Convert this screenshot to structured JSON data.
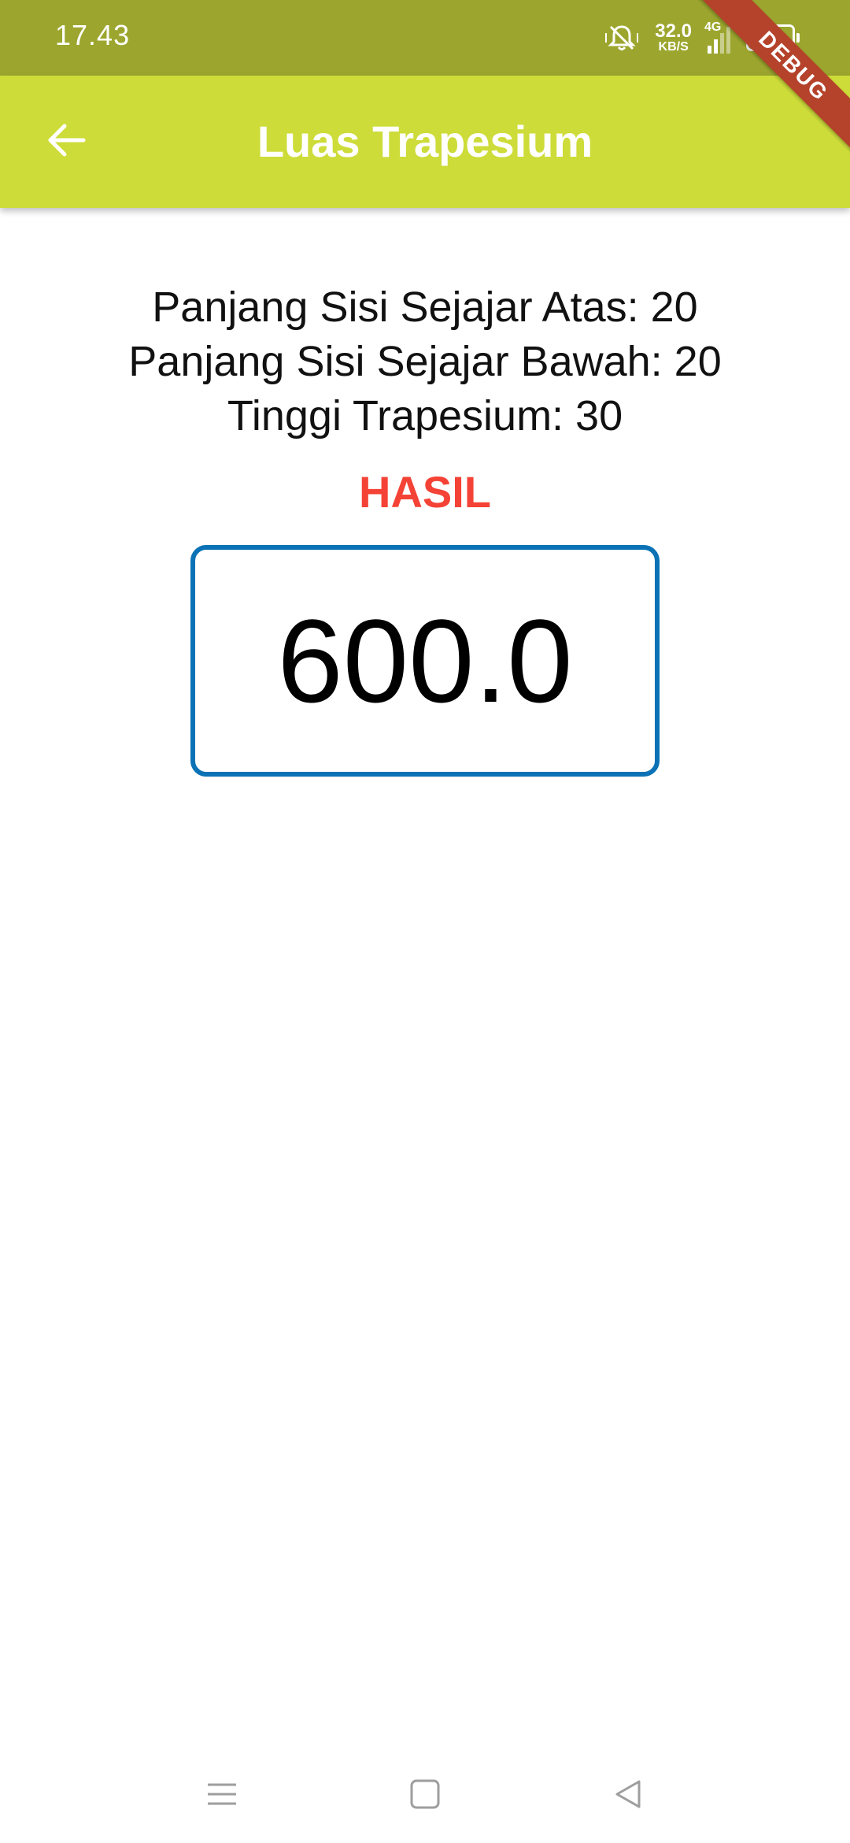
{
  "status_bar": {
    "time": "17.43",
    "net_speed_value": "32.0",
    "net_speed_unit": "KB/S",
    "network_type": "4G",
    "battery_level": "100",
    "icons": [
      "mute-vibrate-icon",
      "signal-icon",
      "battery-icon"
    ]
  },
  "app_bar": {
    "title": "Luas Trapesium",
    "back_icon": "arrow-back-icon",
    "background_color": "#cddc39"
  },
  "debug_banner": {
    "label": "DEBUG"
  },
  "content": {
    "lines": [
      "Panjang Sisi Sejajar Atas: 20",
      "Panjang Sisi Sejajar Bawah: 20",
      "Tinggi Trapesium: 30"
    ],
    "result_label": "HASIL",
    "result_label_color": "#f44336",
    "result_value": "600.0",
    "result_border_color": "#0b72b5"
  },
  "nav_bar": {
    "icons": [
      "menu-icon",
      "home-icon",
      "back-triangle-icon"
    ]
  }
}
